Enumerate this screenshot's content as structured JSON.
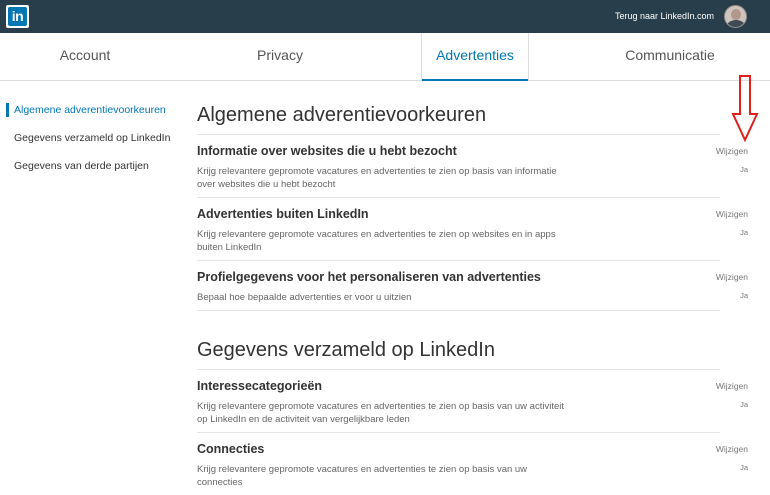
{
  "topbar": {
    "logo_text": "in",
    "back_link": "Terug naar LinkedIn.com"
  },
  "tabs": [
    {
      "label": "Account"
    },
    {
      "label": "Privacy"
    },
    {
      "label": "Advertenties",
      "active": true
    },
    {
      "label": "Communicatie"
    }
  ],
  "sidebar": {
    "items": [
      {
        "label": "Algemene adverentievoorkeuren",
        "active": true
      },
      {
        "label": "Gegevens verzameld op LinkedIn"
      },
      {
        "label": "Gegevens van derde partijen"
      }
    ]
  },
  "sections": [
    {
      "title": "Algemene adverentievoorkeuren",
      "rows": [
        {
          "title": "Informatie over websites die u hebt bezocht",
          "desc": "Krijg relevantere gepromote vacatures en advertenties te zien op basis van informatie over websites die u hebt bezocht",
          "edit": "Wijzigen",
          "value": "Ja"
        },
        {
          "title": "Advertenties buiten LinkedIn",
          "desc": "Krijg relevantere gepromote vacatures en advertenties te zien op websites en in apps buiten LinkedIn",
          "edit": "Wijzigen",
          "value": "Ja"
        },
        {
          "title": "Profielgegevens voor het personaliseren van advertenties",
          "desc": "Bepaal hoe bepaalde advertenties er voor u uitzien",
          "edit": "Wijzigen",
          "value": "Ja"
        }
      ]
    },
    {
      "title": "Gegevens verzameld op LinkedIn",
      "rows": [
        {
          "title": "Interessecategorieën",
          "desc": "Krijg relevantere gepromote vacatures en advertenties te zien op basis van uw activiteit op LinkedIn en de activiteit van vergelijkbare leden",
          "edit": "Wijzigen",
          "value": "Ja"
        },
        {
          "title": "Connecties",
          "desc": "Krijg relevantere gepromote vacatures en advertenties te zien op basis van uw connecties",
          "edit": "Wijzigen",
          "value": "Ja"
        }
      ]
    }
  ],
  "colors": {
    "topbar": "#283e4a",
    "accent": "#0077b5",
    "annotation_arrow": "#e0201c"
  },
  "icons": {
    "logo": "linkedin-logo-icon",
    "avatar": "user-avatar",
    "annotation": "down-arrow-icon"
  }
}
